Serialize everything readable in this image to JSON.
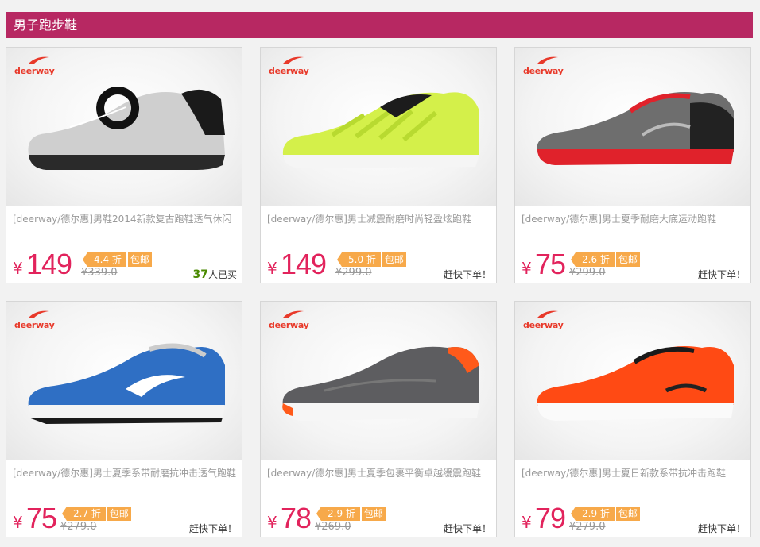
{
  "section_title": "男子跑步鞋",
  "brand": "deerway",
  "colors": {
    "header_bg": "#b72862",
    "price": "#e2235c",
    "tag": "#f7a94a",
    "sold": "#4a8a00"
  },
  "products": [
    {
      "title": "[deerway/德尔惠]男鞋2014新款复古跑鞋透气休闲",
      "yen": "¥",
      "price": "149",
      "discount": "4.4 折",
      "free_ship": "包邮",
      "original": "¥339.0",
      "sold_count": "37",
      "sold_suffix": "人已买",
      "note": ""
    },
    {
      "title": "[deerway/德尔惠]男士减震耐磨时尚轻盈炫跑鞋",
      "yen": "¥",
      "price": "149",
      "discount": "5.0 折",
      "free_ship": "包邮",
      "original": "¥299.0",
      "sold_count": "",
      "sold_suffix": "",
      "note": "赶快下单！"
    },
    {
      "title": "[deerway/德尔惠]男士夏季耐磨大底运动跑鞋",
      "yen": "¥",
      "price": "75",
      "discount": "2.6 折",
      "free_ship": "包邮",
      "original": "¥299.0",
      "sold_count": "",
      "sold_suffix": "",
      "note": "赶快下单！"
    },
    {
      "title": "[deerway/德尔惠]男士夏季系带耐磨抗冲击透气跑鞋",
      "yen": "¥",
      "price": "75",
      "discount": "2.7 折",
      "free_ship": "包邮",
      "original": "¥279.0",
      "sold_count": "",
      "sold_suffix": "",
      "note": "赶快下单！"
    },
    {
      "title": "[deerway/德尔惠]男士夏季包裹平衡卓越缓震跑鞋",
      "yen": "¥",
      "price": "78",
      "discount": "2.9 折",
      "free_ship": "包邮",
      "original": "¥269.0",
      "sold_count": "",
      "sold_suffix": "",
      "note": "赶快下单！"
    },
    {
      "title": "[deerway/德尔惠]男士夏日新款系带抗冲击跑鞋",
      "yen": "¥",
      "price": "79",
      "discount": "2.9 折",
      "free_ship": "包邮",
      "original": "¥279.0",
      "sold_count": "",
      "sold_suffix": "",
      "note": "赶快下单！"
    }
  ]
}
